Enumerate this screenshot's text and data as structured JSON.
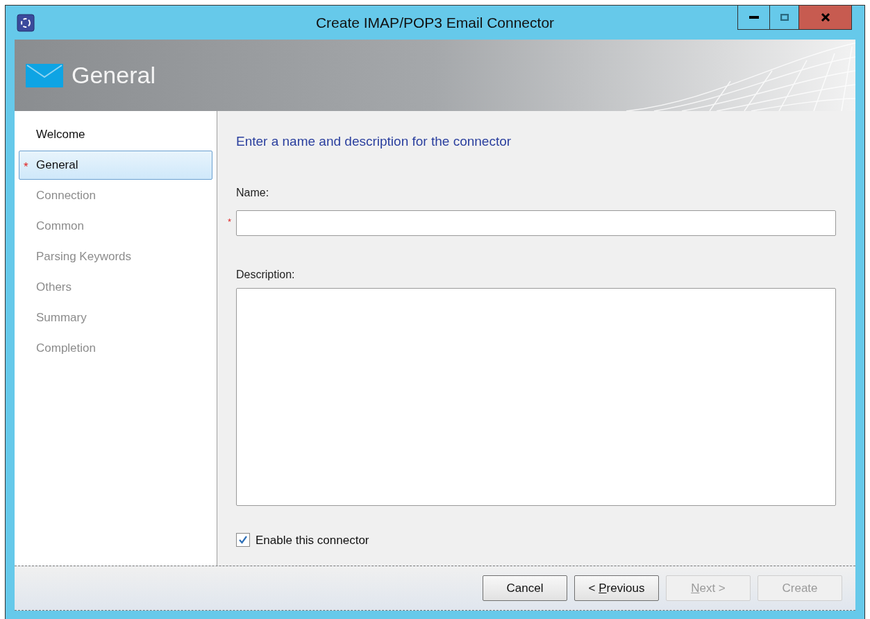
{
  "window": {
    "title": "Create IMAP/POP3 Email Connector"
  },
  "header": {
    "title": "General"
  },
  "sidebar": {
    "items": [
      {
        "label": "Welcome",
        "selected": false,
        "required": false,
        "disabled": false
      },
      {
        "label": "General",
        "selected": true,
        "required": true,
        "disabled": false
      },
      {
        "label": "Connection",
        "selected": false,
        "required": false,
        "disabled": true
      },
      {
        "label": "Common",
        "selected": false,
        "required": false,
        "disabled": true
      },
      {
        "label": "Parsing Keywords",
        "selected": false,
        "required": false,
        "disabled": true
      },
      {
        "label": "Others",
        "selected": false,
        "required": false,
        "disabled": true
      },
      {
        "label": "Summary",
        "selected": false,
        "required": false,
        "disabled": true
      },
      {
        "label": "Completion",
        "selected": false,
        "required": false,
        "disabled": true
      }
    ]
  },
  "form": {
    "heading": "Enter a name and description for the connector",
    "name_label": "Name:",
    "required_mark": "*",
    "description_label": "Description:",
    "enable_checkbox": {
      "label": "Enable this connector",
      "checked": true
    }
  },
  "sidebar_required_mark": "*",
  "buttons": [
    {
      "after": "Cancel",
      "disabled": false
    },
    {
      "before": "< ",
      "access_key": "P",
      "after": "revious",
      "disabled": false
    },
    {
      "access_key": "N",
      "after": "ext >",
      "disabled": true
    },
    {
      "after": "Create",
      "disabled": true
    }
  ]
}
